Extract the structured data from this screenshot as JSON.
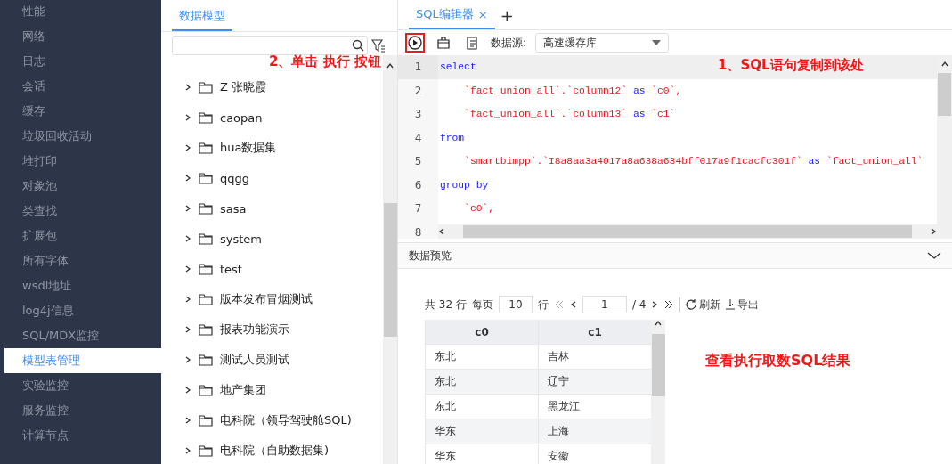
{
  "sidebar": {
    "items": [
      {
        "label": "性能",
        "selected": false
      },
      {
        "label": "网络",
        "selected": false
      },
      {
        "label": "日志",
        "selected": false
      },
      {
        "label": "会话",
        "selected": false
      },
      {
        "label": "缓存",
        "selected": false
      },
      {
        "label": "垃圾回收活动",
        "selected": false
      },
      {
        "label": "堆打印",
        "selected": false
      },
      {
        "label": "对象池",
        "selected": false
      },
      {
        "label": "类查找",
        "selected": false
      },
      {
        "label": "扩展包",
        "selected": false
      },
      {
        "label": "所有字体",
        "selected": false
      },
      {
        "label": "wsdl地址",
        "selected": false
      },
      {
        "label": "log4j信息",
        "selected": false
      },
      {
        "label": "SQL/MDX监控",
        "selected": false
      },
      {
        "label": "模型表管理",
        "selected": true
      },
      {
        "label": "实验监控",
        "selected": false
      },
      {
        "label": "服务监控",
        "selected": false
      },
      {
        "label": "计算节点",
        "selected": false
      }
    ]
  },
  "model_panel": {
    "tab": {
      "label": "数据模型",
      "selected": true
    },
    "tree": [
      {
        "label": "Z 张晓霞",
        "expanded": false
      },
      {
        "label": "caopan",
        "expanded": false
      },
      {
        "label": "hua数据集",
        "expanded": false
      },
      {
        "label": "qqgg",
        "expanded": false
      },
      {
        "label": "sasa",
        "expanded": false
      },
      {
        "label": "system",
        "expanded": false
      },
      {
        "label": "test",
        "expanded": false
      },
      {
        "label": "版本发布冒烟测试",
        "expanded": false
      },
      {
        "label": "报表功能演示",
        "expanded": false
      },
      {
        "label": "测试人员测试",
        "expanded": false
      },
      {
        "label": "地产集团",
        "expanded": false
      },
      {
        "label": "电科院（领导驾驶舱SQL)",
        "expanded": false
      },
      {
        "label": "电科院（自助数据集)",
        "expanded": false
      }
    ]
  },
  "editor": {
    "tabs": [
      {
        "label": "SQL编辑器",
        "close": "×",
        "selected": true
      }
    ],
    "add_tab": "+",
    "datasource_label": "数据源:",
    "datasource": "高速缓存库",
    "lines": [
      {
        "number": "1",
        "tokens": [
          {
            "text": "select",
            "kind": "keyword"
          }
        ]
      },
      {
        "number": "2",
        "tokens": [
          {
            "text": "    `fact_union_all`.`column12`",
            "kind": "string"
          },
          {
            "text": " as ",
            "kind": "keyword"
          },
          {
            "text": "`c0`,",
            "kind": "string"
          }
        ]
      },
      {
        "number": "3",
        "tokens": [
          {
            "text": "    `fact_union_all`.`column13`",
            "kind": "string"
          },
          {
            "text": " as ",
            "kind": "keyword"
          },
          {
            "text": "`c1`",
            "kind": "string"
          }
        ]
      },
      {
        "number": "4",
        "tokens": [
          {
            "text": "from",
            "kind": "keyword"
          }
        ]
      },
      {
        "number": "5",
        "tokens": [
          {
            "text": "    `smartbimpp`.`I8a8aa3a4017a8a638a634bff017a9f1cacfc301f`",
            "kind": "string"
          },
          {
            "text": " as ",
            "kind": "keyword"
          },
          {
            "text": "`fact_union_all`",
            "kind": "string"
          }
        ]
      },
      {
        "number": "6",
        "tokens": [
          {
            "text": "group by",
            "kind": "keyword"
          }
        ]
      },
      {
        "number": "7",
        "tokens": [
          {
            "text": "    `c0`,",
            "kind": "string"
          }
        ]
      },
      {
        "number": "8"
      }
    ]
  },
  "preview": {
    "title": "数据预览",
    "expanded": true,
    "pager": {
      "total": "共 32 行",
      "per_page_label": "每页",
      "per_page": "10",
      "rows_unit": "行",
      "page": "1",
      "page_total": "/ 4",
      "refresh": "刷新",
      "export": "导出"
    },
    "columns": [
      "c0",
      "c1"
    ],
    "rows": [
      [
        "东北",
        "吉林"
      ],
      [
        "东北",
        "辽宁"
      ],
      [
        "东北",
        "黑龙江"
      ],
      [
        "华东",
        "上海"
      ],
      [
        "华东",
        "安徽"
      ]
    ]
  },
  "annotations": {
    "toolbar_note": "2、单击 执行 按钮",
    "editor_note": "1、SQL语句复制到该处",
    "preview_note": "查看执行取数SQL结果"
  }
}
